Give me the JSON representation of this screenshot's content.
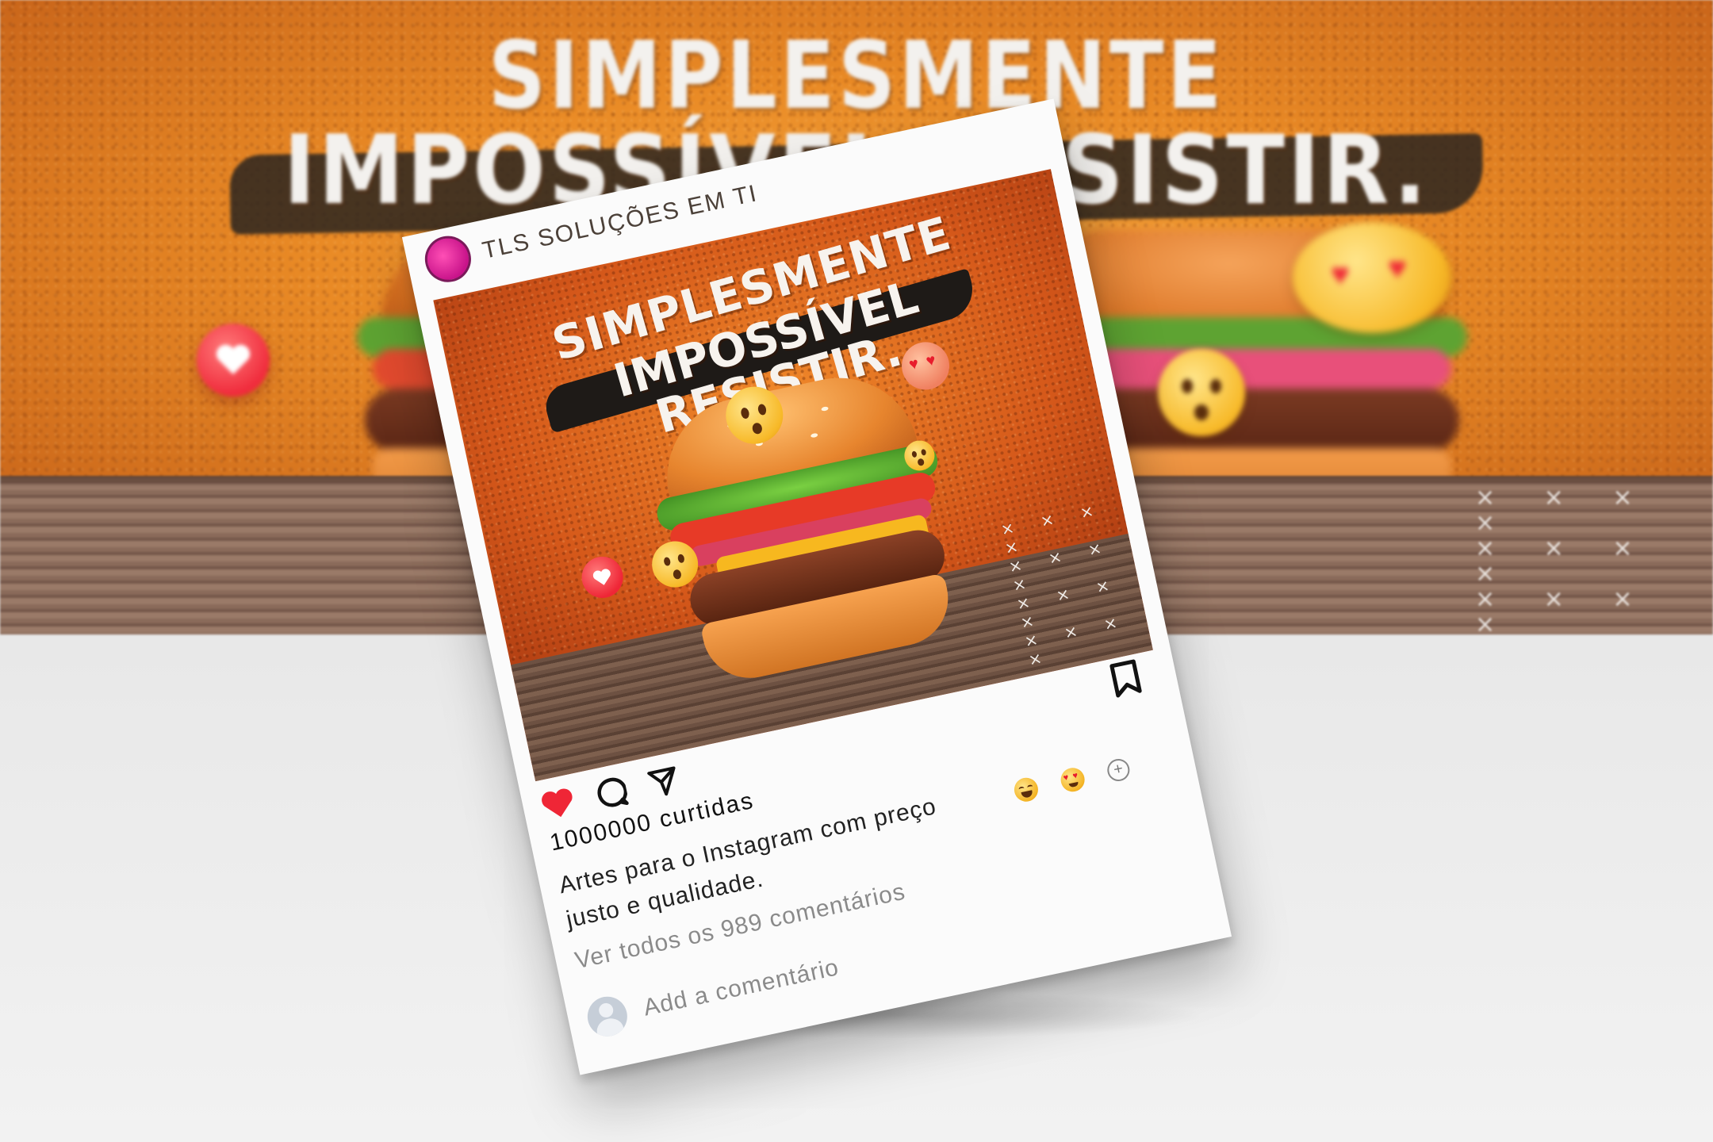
{
  "background": {
    "headline_line1": "SIMPLESMENTE",
    "headline_line2": "IMPOSSÍVEL RESISTIR.",
    "x_pattern": "× × × ×"
  },
  "post": {
    "account_name": "TLS SOLUÇÕES EM TI",
    "logo_text": "TLS SOLUÇÕES EM TI",
    "image_headline_line1": "SIMPLESMENTE",
    "image_headline_line2": "IMPOSSÍVEL RESISTIR.",
    "image_x_pattern": "× × × ×",
    "likes_text": "1000000 curtidas",
    "caption": "Artes para o Instagram com preço justo e qualidade.",
    "view_comments": "Ver todos os 989 comentários",
    "comment_placeholder": "Add a comentário",
    "add_reaction_label": "+"
  },
  "colors": {
    "accent_orange": "#e98a25",
    "like_red": "#ef2636",
    "brand_pink": "#c8138a"
  },
  "icons": [
    "heart-icon",
    "comment-icon",
    "send-icon",
    "bookmark-icon",
    "laughing-emoji-icon",
    "heart-eyes-emoji-icon",
    "add-reaction-icon"
  ]
}
